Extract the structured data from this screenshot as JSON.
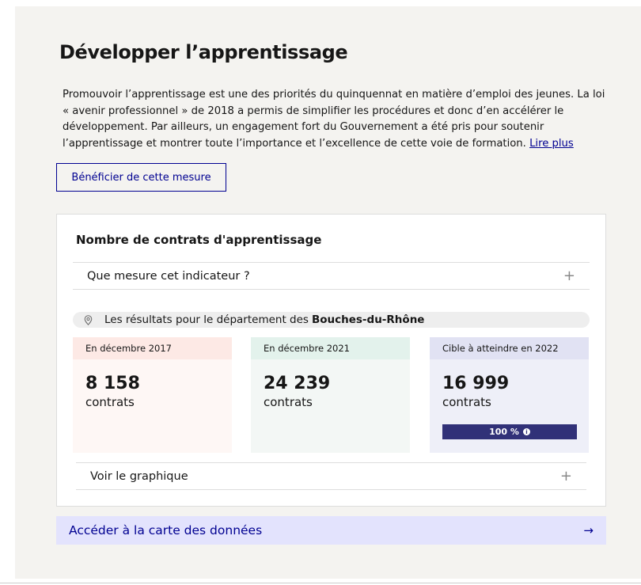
{
  "section": {
    "title": "Développer l’apprentissage",
    "description": "Promouvoir l’apprentissage est une des priorités du quinquennat en matière d’emploi des jeunes. La loi « avenir professionnel » de 2018 a permis de simplifier les procédures et donc d’en accélérer le développement. Par ailleurs, un engagement fort du Gouvernement a été pris pour soutenir l’apprentissage et montrer toute l’importance et l’excellence de cette voie de formation.",
    "read_more": "Lire plus",
    "benefit_button": "Bénéficier de cette mesure"
  },
  "card": {
    "title": "Nombre de contrats d'apprentissage",
    "indicator_accordion": "Que mesure cet indicateur ?",
    "location_prefix": "Les résultats pour le département des",
    "location_name": "Bouches-du-Rhône",
    "boxes": [
      {
        "label": "En décembre 2017",
        "value": "8 158",
        "unit": "contrats"
      },
      {
        "label": "En décembre 2021",
        "value": "24 239",
        "unit": "contrats"
      },
      {
        "label": "Cible à atteindre en 2022",
        "value": "16 999",
        "unit": "contrats"
      }
    ],
    "progress": {
      "label": "100 %",
      "fraction": 1.0
    },
    "chart_accordion": "Voir le graphique",
    "plus_symbol": "+"
  },
  "map_link": {
    "label": "Accéder à la carte des données",
    "arrow": "→"
  },
  "icons": {
    "location": "location-pin-icon",
    "info": "info-icon",
    "plus": "plus-icon",
    "arrow": "arrow-right-icon"
  },
  "colors": {
    "accent": "#000091",
    "box_2017": "#fde9e5",
    "box_2021": "#e3f2ec",
    "box_target": "#e1e2f3",
    "progress": "#313178"
  }
}
